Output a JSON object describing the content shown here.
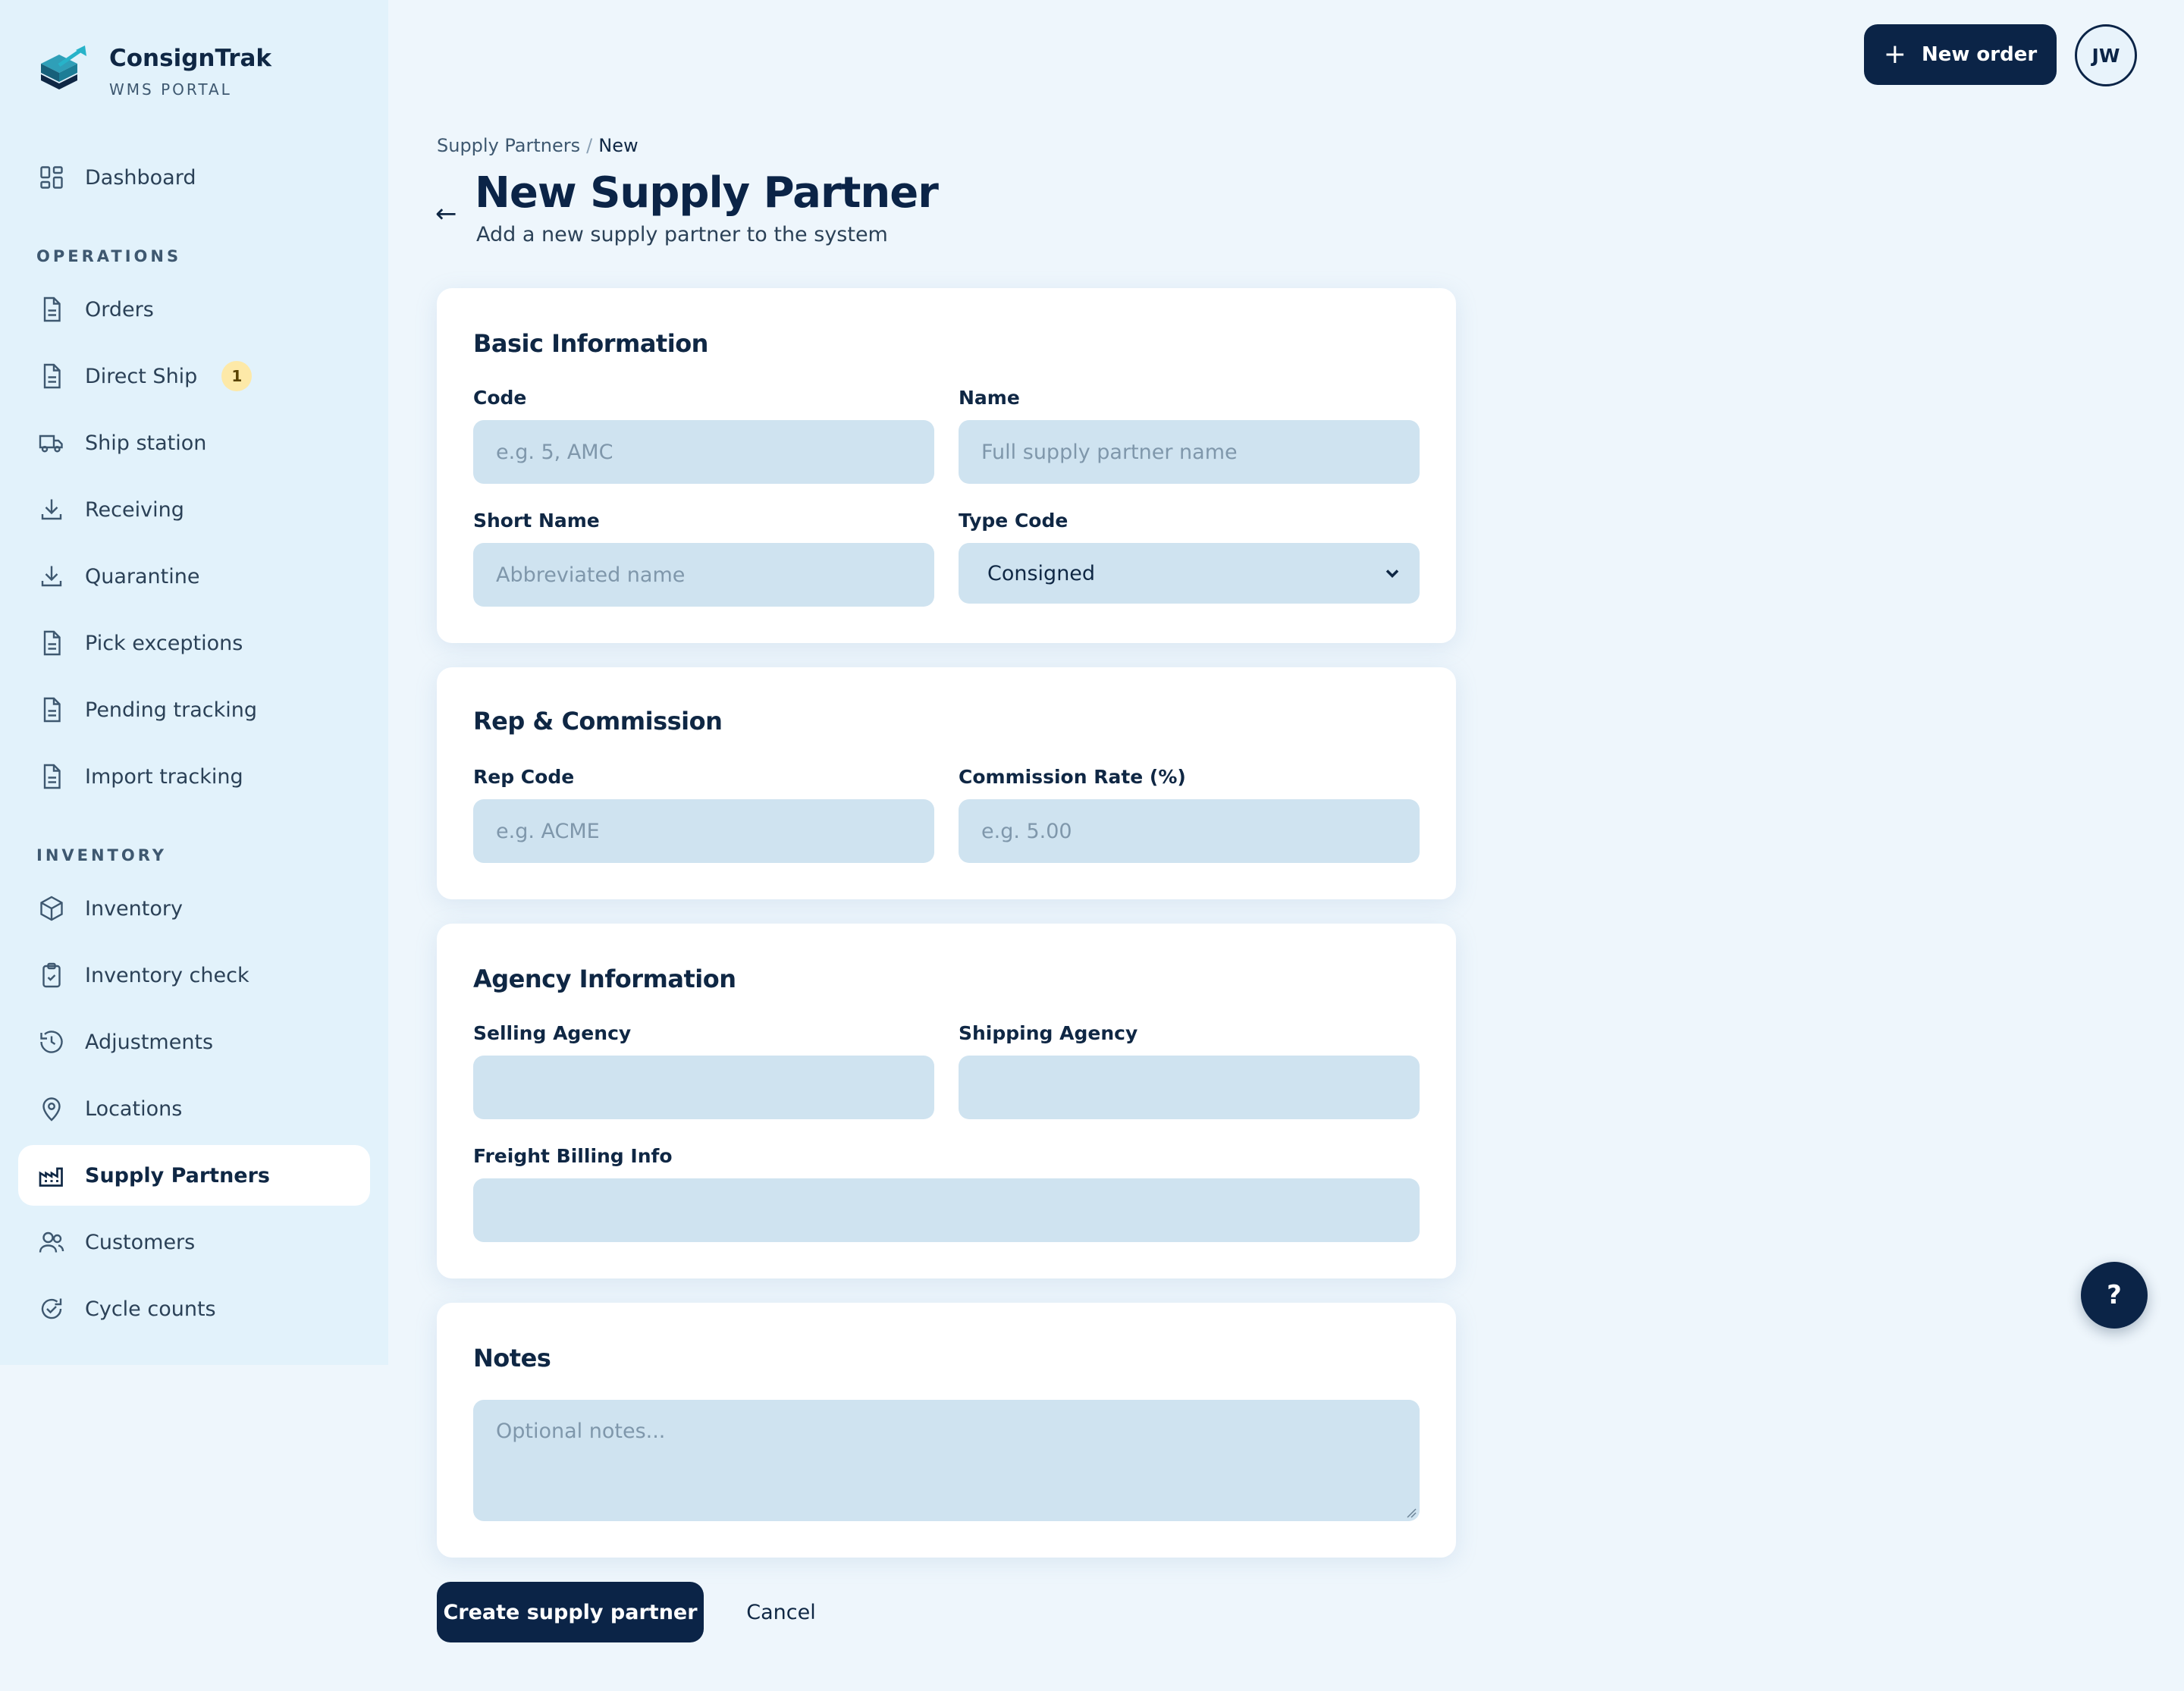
{
  "brand": {
    "name": "ConsignTrak",
    "subtitle": "WMS PORTAL"
  },
  "sidebar": {
    "dashboard": {
      "label": "Dashboard",
      "icon": "grid-icon"
    },
    "operations_title": "OPERATIONS",
    "operations": [
      {
        "label": "Orders",
        "icon": "document-icon"
      },
      {
        "label": "Direct Ship",
        "icon": "document-icon",
        "badge": "1"
      },
      {
        "label": "Ship station",
        "icon": "truck-icon"
      },
      {
        "label": "Receiving",
        "icon": "download-icon"
      },
      {
        "label": "Quarantine",
        "icon": "download-icon"
      },
      {
        "label": "Pick exceptions",
        "icon": "document-icon"
      },
      {
        "label": "Pending tracking",
        "icon": "document-icon"
      },
      {
        "label": "Import tracking",
        "icon": "document-icon"
      }
    ],
    "inventory_title": "INVENTORY",
    "inventory": [
      {
        "label": "Inventory",
        "icon": "box-icon"
      },
      {
        "label": "Inventory check",
        "icon": "clipboard-check-icon"
      },
      {
        "label": "Adjustments",
        "icon": "history-icon"
      },
      {
        "label": "Locations",
        "icon": "map-pin-icon"
      },
      {
        "label": "Supply Partners",
        "icon": "factory-icon",
        "active": true
      },
      {
        "label": "Customers",
        "icon": "users-icon"
      },
      {
        "label": "Cycle counts",
        "icon": "refresh-check-icon"
      }
    ]
  },
  "header": {
    "new_order_label": "New order",
    "avatar_initials": "JW"
  },
  "breadcrumb": {
    "parent": "Supply Partners",
    "separator": "/",
    "current": "New"
  },
  "page": {
    "back_icon": "←",
    "title": "New Supply Partner",
    "subtitle": "Add a new supply partner to the system"
  },
  "basic": {
    "title": "Basic Information",
    "code_label": "Code",
    "code_placeholder": "e.g. 5, AMC",
    "name_label": "Name",
    "name_placeholder": "Full supply partner name",
    "short_label": "Short Name",
    "short_placeholder": "Abbreviated name",
    "type_label": "Type Code",
    "type_value": "Consigned"
  },
  "rep": {
    "title": "Rep & Commission",
    "rep_label": "Rep Code",
    "rep_placeholder": "e.g. ACME",
    "rate_label": "Commission Rate (%)",
    "rate_placeholder": "e.g. 5.00"
  },
  "agency": {
    "title": "Agency Information",
    "selling_label": "Selling Agency",
    "selling_value": "",
    "shipping_label": "Shipping Agency",
    "shipping_value": "",
    "freight_label": "Freight Billing Info",
    "freight_value": ""
  },
  "notes": {
    "title": "Notes",
    "placeholder": "Optional notes..."
  },
  "actions": {
    "create_label": "Create supply partner",
    "cancel_label": "Cancel",
    "help_label": "?"
  },
  "colors": {
    "primary": "#0b2447",
    "sidebar_bg": "#e2f2fb",
    "page_bg": "#eef6fc",
    "input_bg": "#cfe3f0",
    "badge_bg": "#fde9a8"
  }
}
